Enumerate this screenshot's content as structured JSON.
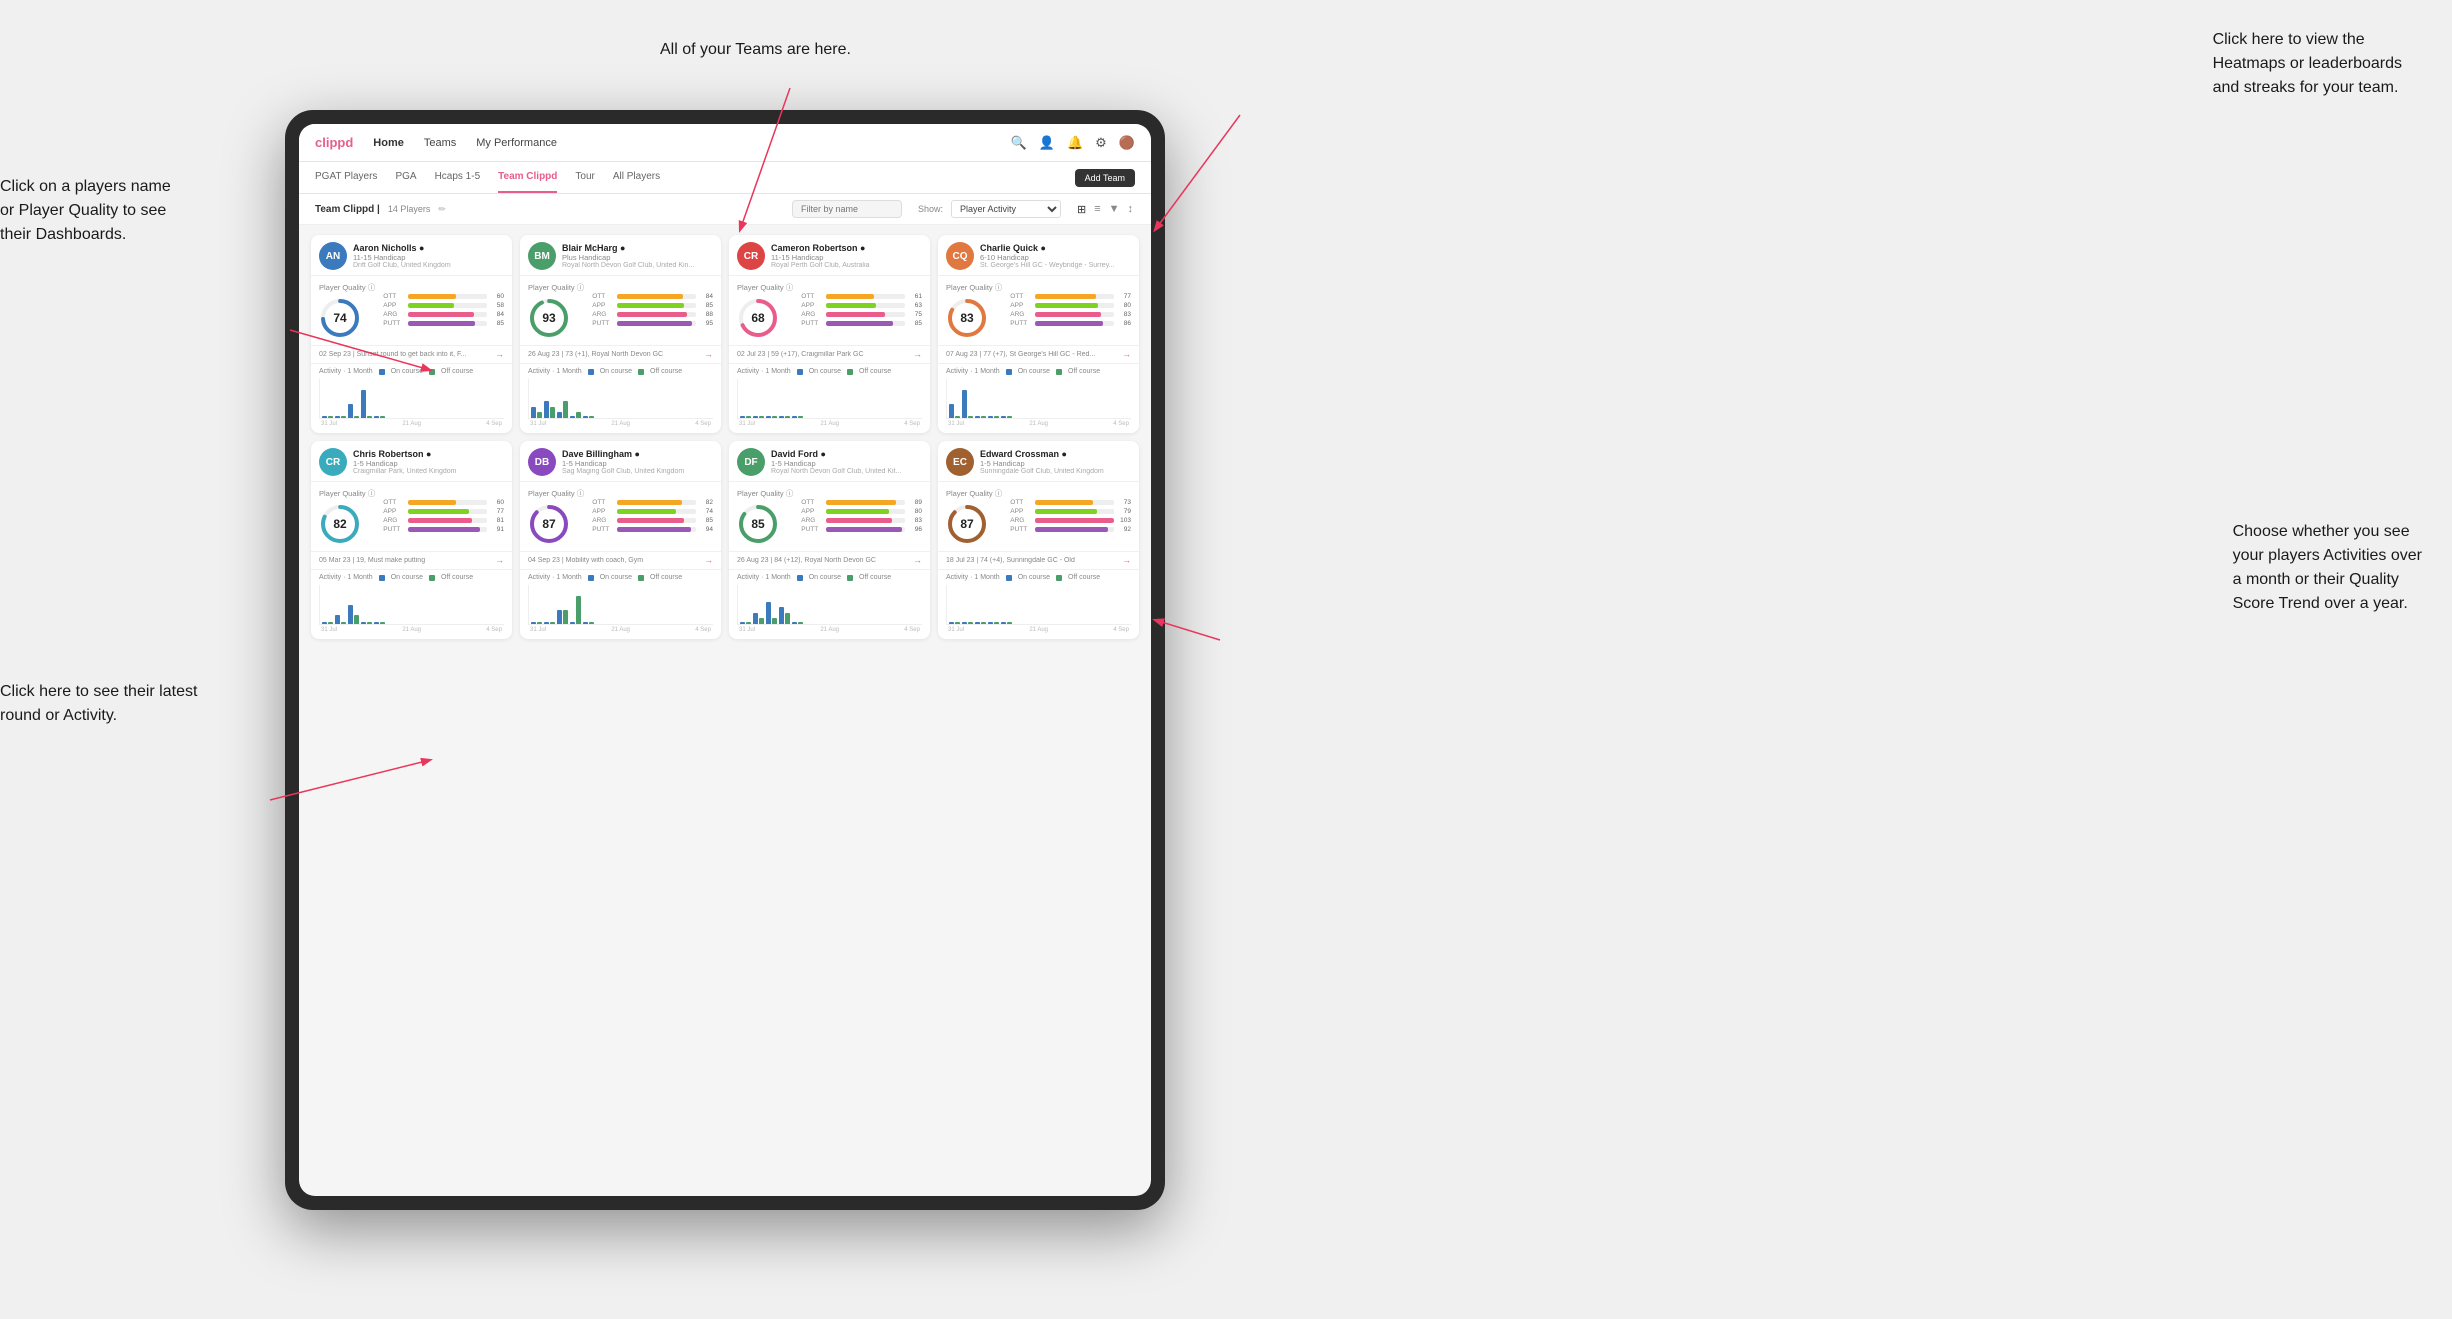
{
  "annotations": {
    "teams_callout": "All of your Teams are here.",
    "heatmaps_callout": "Click here to view the\nHeatmaps or leaderboards\nand streaks for your team.",
    "player_name_callout": "Click on a players name\nor Player Quality to see\ntheir Dashboards.",
    "activities_callout": "Choose whether you see\nyour players Activities over\na month or their Quality\nScore Trend over a year.",
    "latest_round_callout": "Click here to see their latest\nround or Activity."
  },
  "nav": {
    "logo": "clippd",
    "items": [
      "Home",
      "Teams",
      "My Performance"
    ],
    "add_team": "Add Team"
  },
  "sub_nav": {
    "tabs": [
      "PGAT Players",
      "PGA",
      "Hcaps 1-5",
      "Team Clippd",
      "Tour",
      "All Players"
    ]
  },
  "team_header": {
    "title": "Team Clippd",
    "count": "14 Players",
    "search_placeholder": "Filter by name",
    "show_label": "Show:",
    "show_value": "Player Activity"
  },
  "players": [
    {
      "name": "Aaron Nicholls",
      "handicap": "11-15 Handicap",
      "club": "Drift Golf Club, United Kingdom",
      "quality": 74,
      "color": "#3a7abd",
      "initials": "AN",
      "av_class": "av-blue",
      "stats": [
        {
          "label": "OTT",
          "value": 60,
          "color": "#f5a623"
        },
        {
          "label": "APP",
          "value": 58,
          "color": "#7ed321"
        },
        {
          "label": "ARG",
          "value": 84,
          "color": "#e85d8a"
        },
        {
          "label": "PUTT",
          "value": 85,
          "color": "#9b59b6"
        }
      ],
      "latest": "02 Sep 23 | Sunset round to get back into it, F...",
      "activity_bars": [
        {
          "on": 0,
          "off": 0
        },
        {
          "on": 0,
          "off": 0
        },
        {
          "on": 1,
          "off": 0
        },
        {
          "on": 2,
          "off": 0
        },
        {
          "on": 0,
          "off": 0
        }
      ],
      "axis_labels": [
        "31 Jul",
        "21 Aug",
        "4 Sep"
      ]
    },
    {
      "name": "Blair McHarg",
      "handicap": "Plus Handicap",
      "club": "Royal North Devon Golf Club, United Kin...",
      "quality": 93,
      "color": "#4a9e6a",
      "initials": "BM",
      "av_class": "av-green",
      "stats": [
        {
          "label": "OTT",
          "value": 84,
          "color": "#f5a623"
        },
        {
          "label": "APP",
          "value": 85,
          "color": "#7ed321"
        },
        {
          "label": "ARG",
          "value": 88,
          "color": "#e85d8a"
        },
        {
          "label": "PUTT",
          "value": 95,
          "color": "#9b59b6"
        }
      ],
      "latest": "26 Aug 23 | 73 (+1), Royal North Devon GC",
      "activity_bars": [
        {
          "on": 2,
          "off": 1
        },
        {
          "on": 3,
          "off": 2
        },
        {
          "on": 1,
          "off": 3
        },
        {
          "on": 0,
          "off": 1
        },
        {
          "on": 0,
          "off": 0
        }
      ],
      "axis_labels": [
        "31 Jul",
        "21 Aug",
        "4 Sep"
      ]
    },
    {
      "name": "Cameron Robertson",
      "handicap": "11-15 Handicap",
      "club": "Royal Perth Golf Club, Australia",
      "quality": 68,
      "color": "#e85d8a",
      "initials": "CR",
      "av_class": "av-red",
      "stats": [
        {
          "label": "OTT",
          "value": 61,
          "color": "#f5a623"
        },
        {
          "label": "APP",
          "value": 63,
          "color": "#7ed321"
        },
        {
          "label": "ARG",
          "value": 75,
          "color": "#e85d8a"
        },
        {
          "label": "PUTT",
          "value": 85,
          "color": "#9b59b6"
        }
      ],
      "latest": "02 Jul 23 | 59 (+17), Craigmillar Park GC",
      "activity_bars": [
        {
          "on": 0,
          "off": 0
        },
        {
          "on": 0,
          "off": 0
        },
        {
          "on": 0,
          "off": 0
        },
        {
          "on": 0,
          "off": 0
        },
        {
          "on": 0,
          "off": 0
        }
      ],
      "axis_labels": [
        "31 Jul",
        "21 Aug",
        "4 Sep"
      ]
    },
    {
      "name": "Charlie Quick",
      "handicap": "6-10 Handicap",
      "club": "St. George's Hill GC - Weybridge - Surrey...",
      "quality": 83,
      "color": "#e07840",
      "initials": "CQ",
      "av_class": "av-orange",
      "stats": [
        {
          "label": "OTT",
          "value": 77,
          "color": "#f5a623"
        },
        {
          "label": "APP",
          "value": 80,
          "color": "#7ed321"
        },
        {
          "label": "ARG",
          "value": 83,
          "color": "#e85d8a"
        },
        {
          "label": "PUTT",
          "value": 86,
          "color": "#9b59b6"
        }
      ],
      "latest": "07 Aug 23 | 77 (+7), St George's Hill GC - Red...",
      "activity_bars": [
        {
          "on": 1,
          "off": 0
        },
        {
          "on": 2,
          "off": 0
        },
        {
          "on": 0,
          "off": 0
        },
        {
          "on": 0,
          "off": 0
        },
        {
          "on": 0,
          "off": 0
        }
      ],
      "axis_labels": [
        "31 Jul",
        "21 Aug",
        "4 Sep"
      ]
    },
    {
      "name": "Chris Robertson",
      "handicap": "1-5 Handicap",
      "club": "Craigmillar Park, United Kingdom",
      "quality": 82,
      "color": "#3aabbd",
      "initials": "CR",
      "av_class": "av-teal",
      "stats": [
        {
          "label": "OTT",
          "value": 60,
          "color": "#f5a623"
        },
        {
          "label": "APP",
          "value": 77,
          "color": "#7ed321"
        },
        {
          "label": "ARG",
          "value": 81,
          "color": "#e85d8a"
        },
        {
          "label": "PUTT",
          "value": 91,
          "color": "#9b59b6"
        }
      ],
      "latest": "05 Mar 23 | 19, Must make putting",
      "activity_bars": [
        {
          "on": 0,
          "off": 0
        },
        {
          "on": 1,
          "off": 0
        },
        {
          "on": 2,
          "off": 1
        },
        {
          "on": 0,
          "off": 0
        },
        {
          "on": 0,
          "off": 0
        }
      ],
      "axis_labels": [
        "31 Jul",
        "21 Aug",
        "4 Sep"
      ]
    },
    {
      "name": "Dave Billingham",
      "handicap": "1-5 Handicap",
      "club": "Sag Maging Golf Club, United Kingdom",
      "quality": 87,
      "color": "#8a4abf",
      "initials": "DB",
      "av_class": "av-purple",
      "stats": [
        {
          "label": "OTT",
          "value": 82,
          "color": "#f5a623"
        },
        {
          "label": "APP",
          "value": 74,
          "color": "#7ed321"
        },
        {
          "label": "ARG",
          "value": 85,
          "color": "#e85d8a"
        },
        {
          "label": "PUTT",
          "value": 94,
          "color": "#9b59b6"
        }
      ],
      "latest": "04 Sep 23 | Mobility with coach, Gym",
      "activity_bars": [
        {
          "on": 0,
          "off": 0
        },
        {
          "on": 0,
          "off": 0
        },
        {
          "on": 1,
          "off": 1
        },
        {
          "on": 0,
          "off": 2
        },
        {
          "on": 0,
          "off": 0
        }
      ],
      "axis_labels": [
        "31 Jul",
        "21 Aug",
        "4 Sep"
      ]
    },
    {
      "name": "David Ford",
      "handicap": "1-5 Handicap",
      "club": "Royal North Devon Golf Club, United Kit...",
      "quality": 85,
      "color": "#4a9e6a",
      "initials": "DF",
      "av_class": "av-green",
      "stats": [
        {
          "label": "OTT",
          "value": 89,
          "color": "#f5a623"
        },
        {
          "label": "APP",
          "value": 80,
          "color": "#7ed321"
        },
        {
          "label": "ARG",
          "value": 83,
          "color": "#e85d8a"
        },
        {
          "label": "PUTT",
          "value": 96,
          "color": "#9b59b6"
        }
      ],
      "latest": "26 Aug 23 | 84 (+12), Royal North Devon GC",
      "activity_bars": [
        {
          "on": 0,
          "off": 0
        },
        {
          "on": 2,
          "off": 1
        },
        {
          "on": 4,
          "off": 1
        },
        {
          "on": 3,
          "off": 2
        },
        {
          "on": 0,
          "off": 0
        }
      ],
      "axis_labels": [
        "31 Jul",
        "21 Aug",
        "4 Sep"
      ]
    },
    {
      "name": "Edward Crossman",
      "handicap": "1-5 Handicap",
      "club": "Sunningdale Golf Club, United Kingdom",
      "quality": 87,
      "color": "#a06030",
      "initials": "EC",
      "av_class": "av-brown",
      "stats": [
        {
          "label": "OTT",
          "value": 73,
          "color": "#f5a623"
        },
        {
          "label": "APP",
          "value": 79,
          "color": "#7ed321"
        },
        {
          "label": "ARG",
          "value": 103,
          "color": "#e85d8a"
        },
        {
          "label": "PUTT",
          "value": 92,
          "color": "#9b59b6"
        }
      ],
      "latest": "18 Jul 23 | 74 (+4), Sunningdale GC - Old",
      "activity_bars": [
        {
          "on": 0,
          "off": 0
        },
        {
          "on": 0,
          "off": 0
        },
        {
          "on": 0,
          "off": 0
        },
        {
          "on": 0,
          "off": 0
        },
        {
          "on": 0,
          "off": 0
        }
      ],
      "axis_labels": [
        "31 Jul",
        "21 Aug",
        "4 Sep"
      ]
    }
  ]
}
